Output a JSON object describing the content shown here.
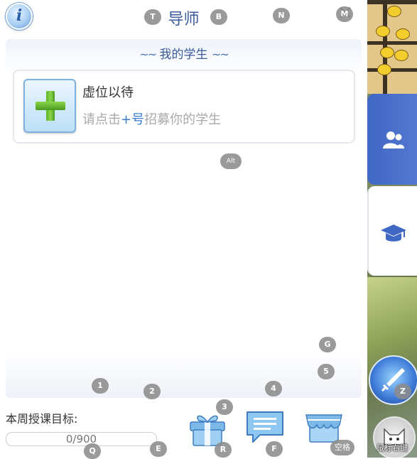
{
  "header": {
    "info_label": "i",
    "title": "导师",
    "close_label": "✕"
  },
  "section": {
    "title": "我的学生",
    "swirl_left": "~~",
    "swirl_right": "~~"
  },
  "student_slot": {
    "title": "虚位以待",
    "hint_before": "请点击",
    "hint_plus": "+号",
    "hint_after": "招募你的学生"
  },
  "weekly_goal": {
    "label": "本周授课目标:",
    "progress_text": "0/900",
    "current": 0,
    "target": 900
  },
  "bottom_icons": [
    {
      "name": "gift-icon"
    },
    {
      "name": "message-icon"
    },
    {
      "name": "shop-icon"
    }
  ],
  "hotkeys": {
    "t": "T",
    "b": "B",
    "n": "N",
    "m": "M",
    "alt": "Alt",
    "g": "G",
    "five": "5",
    "one": "1",
    "two": "2",
    "three": "3",
    "four": "4",
    "q": "Q",
    "e": "E",
    "r": "R",
    "f": "F",
    "space": "空格",
    "z": "Z"
  },
  "side": {
    "tab_students_icon": "people-icon",
    "tab_mentor_icon": "graduation-cap-icon",
    "mouse_label": "鼠标右键"
  },
  "colors": {
    "accent": "#3b5a9a",
    "tab_blue": "#3f67c4",
    "plus_green": "#5fb329",
    "hint_gray": "#a9a9a9"
  }
}
